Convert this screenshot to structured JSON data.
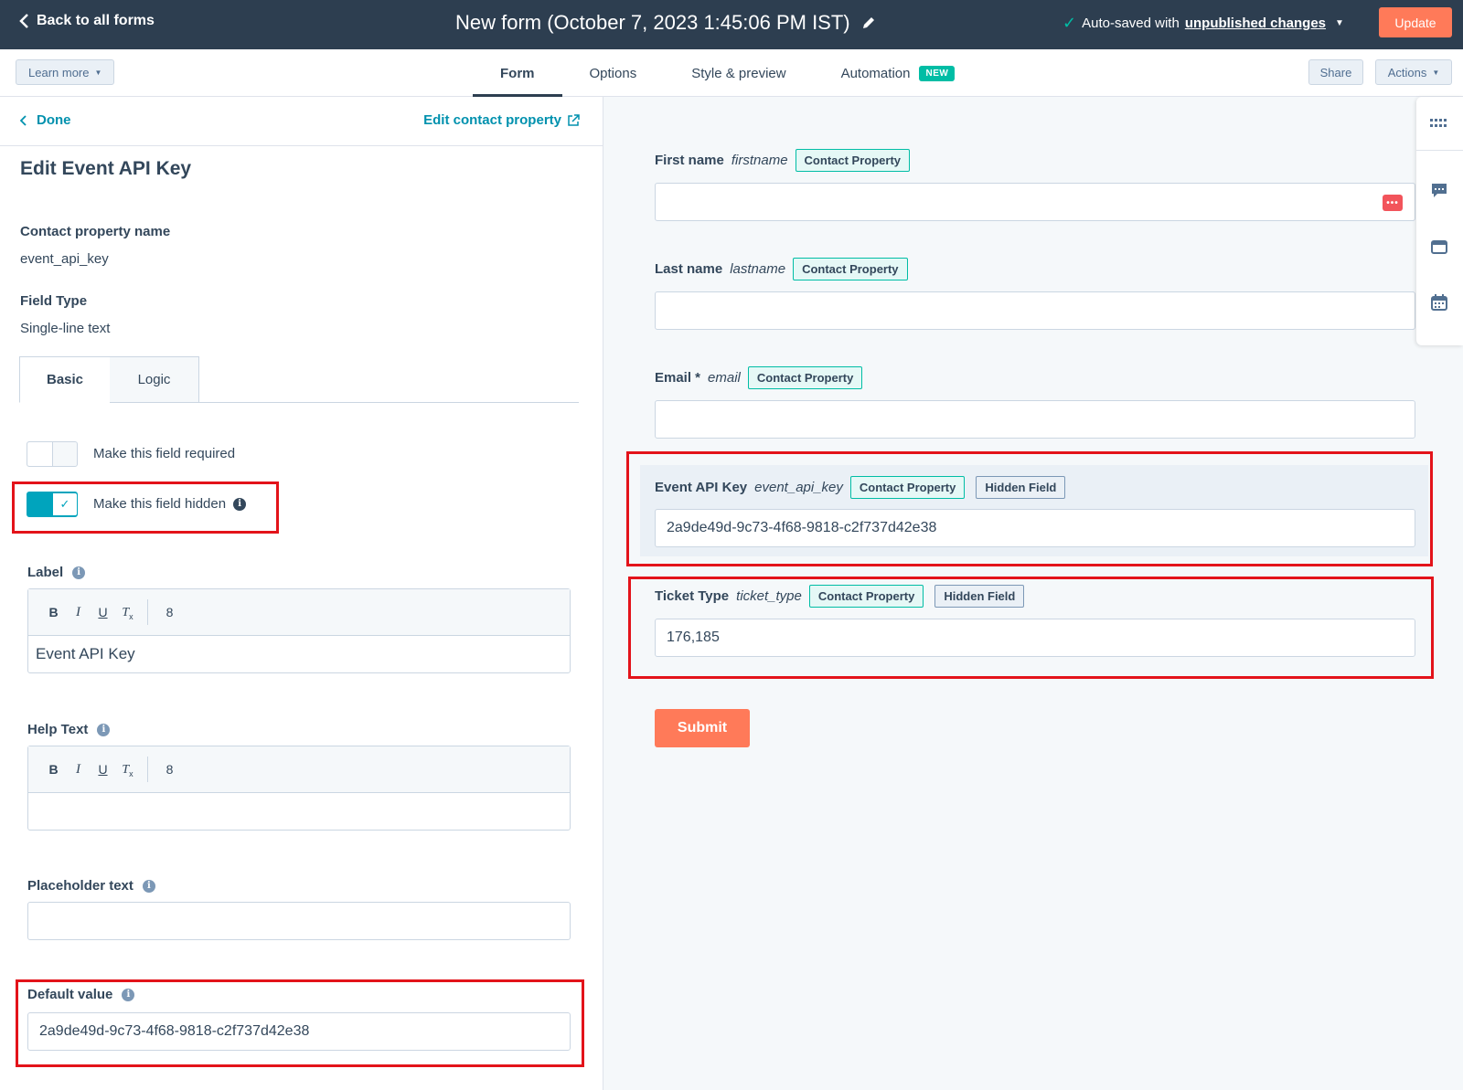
{
  "topbar": {
    "back_label": "Back to all forms",
    "title": "New form (October 7, 2023 1:45:06 PM IST)",
    "autosave_prefix": "Auto-saved with",
    "autosave_link": "unpublished changes",
    "update_label": "Update"
  },
  "subbar": {
    "learn_more": "Learn more",
    "tabs": [
      {
        "label": "Form",
        "active": true
      },
      {
        "label": "Options"
      },
      {
        "label": "Style & preview"
      },
      {
        "label": "Automation",
        "badge": "NEW"
      }
    ],
    "share": "Share",
    "actions": "Actions"
  },
  "left_panel": {
    "done_label": "Done",
    "edit_property_label": "Edit contact property",
    "title": "Edit Event API Key",
    "contact_property_name_label": "Contact property name",
    "contact_property_name_value": "event_api_key",
    "field_type_label": "Field Type",
    "field_type_value": "Single-line text",
    "subtabs": [
      "Basic",
      "Logic"
    ],
    "required_toggle_label": "Make this field required",
    "hidden_toggle_label": "Make this field hidden",
    "label_heading": "Label",
    "label_value": "Event API Key",
    "help_text_heading": "Help Text",
    "help_text_value": "",
    "placeholder_heading": "Placeholder text",
    "placeholder_value": "",
    "default_value_heading": "Default value",
    "default_value": "2a9de49d-9c73-4f68-9818-c2f737d42e38",
    "toolbar": {
      "bold": "B",
      "italic": "I",
      "underline": "U",
      "clear": "Tx",
      "link": "8"
    }
  },
  "preview": {
    "fields": [
      {
        "label": "First name",
        "api": "firstname",
        "tag": "Contact Property",
        "value": ""
      },
      {
        "label": "Last name",
        "api": "lastname",
        "tag": "Contact Property",
        "value": ""
      },
      {
        "label": "Email *",
        "api": "email",
        "tag": "Contact Property",
        "value": ""
      },
      {
        "label": "Event API Key",
        "api": "event_api_key",
        "tag": "Contact Property",
        "hidden_tag": "Hidden Field",
        "value": "2a9de49d-9c73-4f68-9818-c2f737d42e38"
      },
      {
        "label": "Ticket Type",
        "api": "ticket_type",
        "tag": "Contact Property",
        "hidden_tag": "Hidden Field",
        "value": "176,185"
      }
    ],
    "submit_label": "Submit"
  },
  "colors": {
    "topbar": "#2d3e50",
    "accent_orange": "#ff7a59",
    "link_teal": "#0091ae",
    "toggle_on": "#00a4bd",
    "highlight_red": "#e3131a"
  },
  "icons": {
    "back": "chevron-left-icon",
    "edit": "pencil-icon",
    "autosave": "check-icon",
    "external": "external-link-icon",
    "info": "info-icon",
    "rail": [
      "grid-icon",
      "chat-icon",
      "window-icon",
      "calendar-icon"
    ]
  }
}
